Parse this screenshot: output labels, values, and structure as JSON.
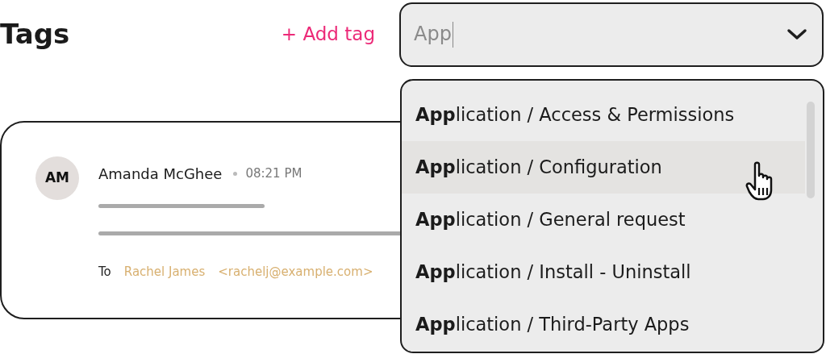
{
  "title": "Tags",
  "add_tag": "+ Add tag",
  "tag_field": {
    "value": "App",
    "expanded": true
  },
  "message": {
    "avatar": "AM",
    "sender": "Amanda McGhee",
    "time": "08:21 PM",
    "to_label": "To",
    "recipient": "Rachel James",
    "email": "<rachelj@example.com>"
  },
  "options": [
    {
      "label": "**App**lication / Access & Permissions",
      "selected": false
    },
    {
      "label": "**App**lication / Configuration",
      "selected": true
    },
    {
      "label": "**App**lication / General request",
      "selected": false
    },
    {
      "label": "**App**lication / Install - Uninstall",
      "selected": false
    },
    {
      "label": "**App**lication / Third-Party Apps",
      "selected": false
    }
  ]
}
